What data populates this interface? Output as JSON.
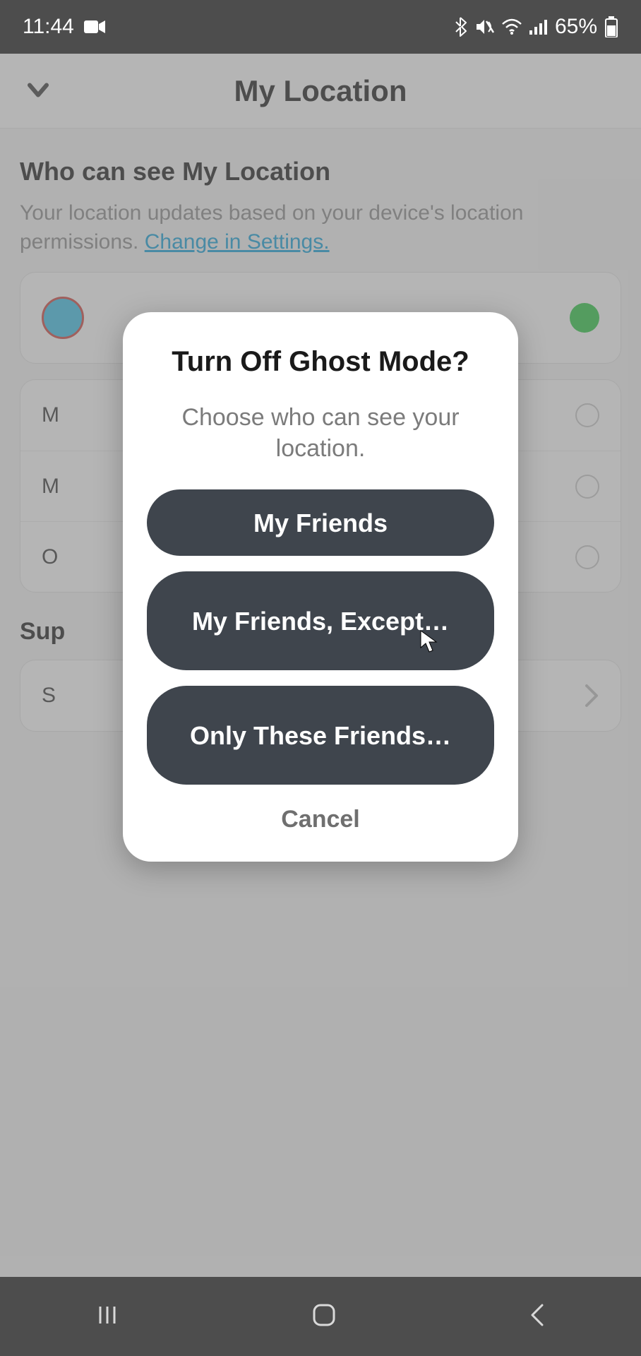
{
  "statusbar": {
    "time": "11:44",
    "battery_text": "65%"
  },
  "header": {
    "title": "My Location"
  },
  "section": {
    "title": "Who can see My Location",
    "subtitle_prefix": "Your location updates based on your device's location permissions. ",
    "subtitle_link": "Change in Settings."
  },
  "options": {
    "row1_label": "M",
    "row2_label": "M",
    "row3_label": "O"
  },
  "support": {
    "heading_visible": "Sup",
    "item_label_visible": "S"
  },
  "modal": {
    "title": "Turn Off Ghost Mode?",
    "subtitle": "Choose who can see your location.",
    "btn_my_friends": "My Friends",
    "btn_except": "My Friends, Except…",
    "btn_only": "Only These Friends…",
    "cancel": "Cancel"
  }
}
